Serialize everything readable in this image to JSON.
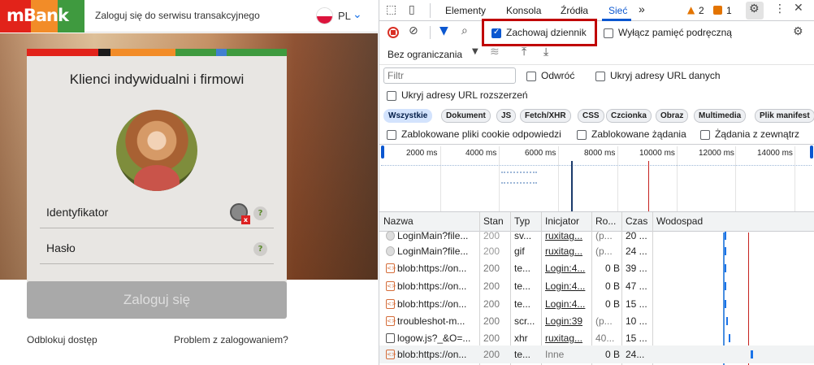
{
  "bank": {
    "logo_text": "mBank",
    "header_text": "Zaloguj się do serwisu transakcyjnego",
    "lang": "PL",
    "card_title": "Klienci indywidualni i firmowi",
    "identifier_label": "Identyfikator",
    "password_label": "Hasło",
    "help_glyph": "?",
    "login_button": "Zaloguj się",
    "unlock_link": "Odblokuj dostęp",
    "problem_link": "Problem z zalogowaniem?",
    "colors": {
      "red": "#e2231a",
      "orange": "#f28c28",
      "green": "#3f9a3f",
      "button": "#a9a9a9"
    }
  },
  "devtools": {
    "tabs": [
      "Elementy",
      "Konsola",
      "Źródła",
      "Sieć"
    ],
    "active_tab": "Sieć",
    "more_tabs": "»",
    "warn_count": "2",
    "err_count": "1",
    "preserve_log": "Zachowaj dziennik",
    "disable_cache": "Wyłącz pamięć podręczną",
    "throttling": "Bez ograniczania",
    "filter_placeholder": "Filtr",
    "invert": "Odwróć",
    "hide_data_urls": "Ukryj adresy URL danych",
    "hide_ext_urls": "Ukryj adresy URL rozszerzeń",
    "type_filters": [
      "Wszystkie",
      "Dokument",
      "JS",
      "Fetch/XHR",
      "CSS",
      "Czcionka",
      "Obraz",
      "Multimedia",
      "Plik manifest"
    ],
    "blocked_cookies": "Zablokowane pliki cookie odpowiedzi",
    "blocked_requests": "Zablokowane żądania",
    "third_party": "Żądania z zewnątrz",
    "timeline_ticks": [
      "2000 ms",
      "4000 ms",
      "6000 ms",
      "8000 ms",
      "10000 ms",
      "12000 ms",
      "14000 ms"
    ],
    "columns": [
      "Nazwa",
      "Stan",
      "Typ",
      "Inicjator",
      "Ro...",
      "Czas",
      "Wodospad"
    ],
    "rows": [
      {
        "name": "LoginMain?file...",
        "status": "200",
        "type": "sv...",
        "initiator": "ruxitag...",
        "size": "(p...",
        "time": "20 ..."
      },
      {
        "name": "LoginMain?file...",
        "status": "200",
        "type": "gif",
        "initiator": "ruxitag...",
        "size": "(p...",
        "time": "24 ..."
      },
      {
        "name": "blob:https://on...",
        "status": "200",
        "type": "te...",
        "initiator": "Login:4...",
        "size": "0 B",
        "time": "39 ..."
      },
      {
        "name": "blob:https://on...",
        "status": "200",
        "type": "te...",
        "initiator": "Login:4...",
        "size": "0 B",
        "time": "47 ..."
      },
      {
        "name": "blob:https://on...",
        "status": "200",
        "type": "te...",
        "initiator": "Login:4...",
        "size": "0 B",
        "time": "15 ..."
      },
      {
        "name": "troubleshot-m...",
        "status": "200",
        "type": "scr...",
        "initiator": "Login:39",
        "size": "(p...",
        "time": "10 ..."
      },
      {
        "name": "logow.js?_&O=...",
        "status": "200",
        "type": "xhr",
        "initiator": "ruxitag...",
        "size": "40...",
        "time": "15 ..."
      },
      {
        "name": "blob:https://on...",
        "status": "200",
        "type": "te...",
        "initiator": "Inne",
        "size": "0 B",
        "time": "24..."
      }
    ]
  }
}
